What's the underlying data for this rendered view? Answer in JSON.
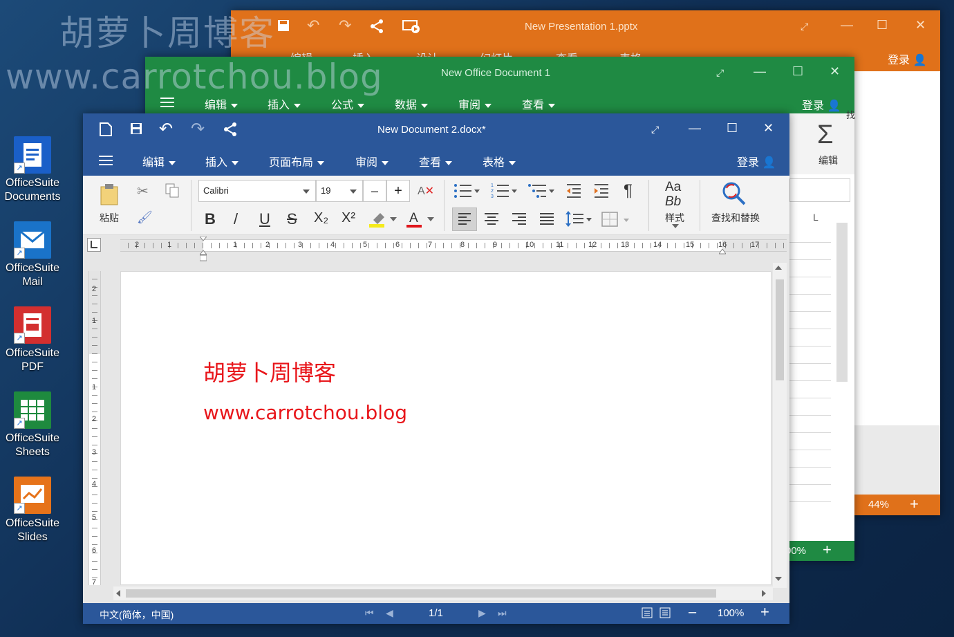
{
  "watermark": {
    "line1": "胡萝卜周博客",
    "line2": "www.carrotchou.blog"
  },
  "desktop": {
    "icons": [
      {
        "label1": "OfficeSuite",
        "label2": "Documents",
        "color": "#1a5fc8",
        "icon": "documents-icon"
      },
      {
        "label1": "OfficeSuite",
        "label2": "Mail",
        "color": "#1a73c9",
        "icon": "mail-icon"
      },
      {
        "label1": "OfficeSuite",
        "label2": "PDF",
        "color": "#d32f2f",
        "icon": "pdf-icon"
      },
      {
        "label1": "OfficeSuite",
        "label2": "Sheets",
        "color": "#1e8a3e",
        "icon": "sheets-icon"
      },
      {
        "label1": "OfficeSuite",
        "label2": "Slides",
        "color": "#e6731a",
        "icon": "slides-icon"
      }
    ]
  },
  "slides_window": {
    "title": "New Presentation 1.pptx",
    "menu": [
      "编辑",
      "插入",
      "设计",
      "幻灯片",
      "查看",
      "表格"
    ],
    "login": "登录",
    "zoom": "44%",
    "color": "#e0711a"
  },
  "sheets_window": {
    "title": "New Office Document 1",
    "menu": [
      "编辑",
      "插入",
      "公式",
      "数据",
      "审阅",
      "查看"
    ],
    "login": "登录",
    "edit_label": "编辑",
    "find_partial": "找",
    "column_label": "L",
    "zoom_partial": "00%",
    "color": "#1f8a43"
  },
  "doc_window": {
    "title": "New Document 2.docx*",
    "menu": [
      "编辑",
      "插入",
      "页面布局",
      "审阅",
      "查看",
      "表格"
    ],
    "login": "登录",
    "color": "#2b579a",
    "ribbon": {
      "paste": "粘贴",
      "font_name": "Calibri",
      "font_size": "19",
      "minus": "–",
      "plus": "+",
      "bold": "B",
      "italic": "/",
      "underline": "U",
      "strike": "S",
      "sub": "X₂",
      "sup": "X²",
      "pilcrow": "¶",
      "styles_top": "Aa",
      "styles_mid": "Bb",
      "styles_label": "样式",
      "find_replace": "查找和替换"
    },
    "ruler_h": [
      "2",
      "1",
      "",
      "1",
      "2",
      "3",
      "4",
      "5",
      "6",
      "7",
      "8",
      "9",
      "10",
      "11",
      "12",
      "13",
      "14",
      "15",
      "16",
      "17"
    ],
    "ruler_v": [
      "2",
      "1",
      "",
      "1",
      "2",
      "3",
      "4",
      "5",
      "6",
      "7"
    ],
    "content": {
      "line1": "胡萝卜周博客",
      "line2": "www.carrotchou.blog",
      "text_color": "#e8161b"
    },
    "status": {
      "language": "中文(简体，中国)",
      "page": "1/1",
      "zoom": "100%",
      "minus": "–",
      "plus": "+"
    }
  }
}
